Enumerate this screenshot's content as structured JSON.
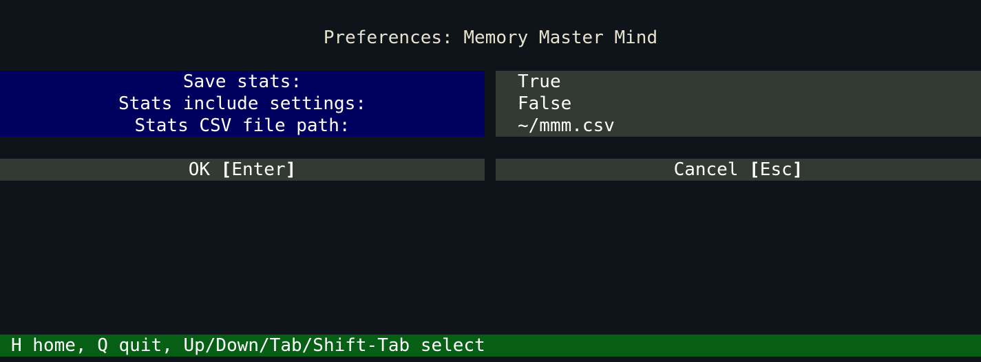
{
  "window": {
    "title": "Preferences: Memory Master Mind"
  },
  "settings": [
    {
      "label": "Save stats:",
      "value": "True"
    },
    {
      "label": "Stats include settings:",
      "value": "False"
    },
    {
      "label": "Stats CSV file path:",
      "value": "~/mmm.csv"
    }
  ],
  "buttons": {
    "ok": {
      "text": "OK ",
      "key": "Enter"
    },
    "cancel": {
      "text": "Cancel ",
      "key": "Esc"
    }
  },
  "status_bar": {
    "text": "H home, Q quit, Up/Down/Tab/Shift-Tab select"
  },
  "colors": {
    "background": "#0f131a",
    "labels_panel": "#00005e",
    "values_panel": "#333a33",
    "button": "#333a33",
    "status_bar": "#075f15",
    "title_text": "#e7e2cc",
    "text": "#ffffff"
  }
}
